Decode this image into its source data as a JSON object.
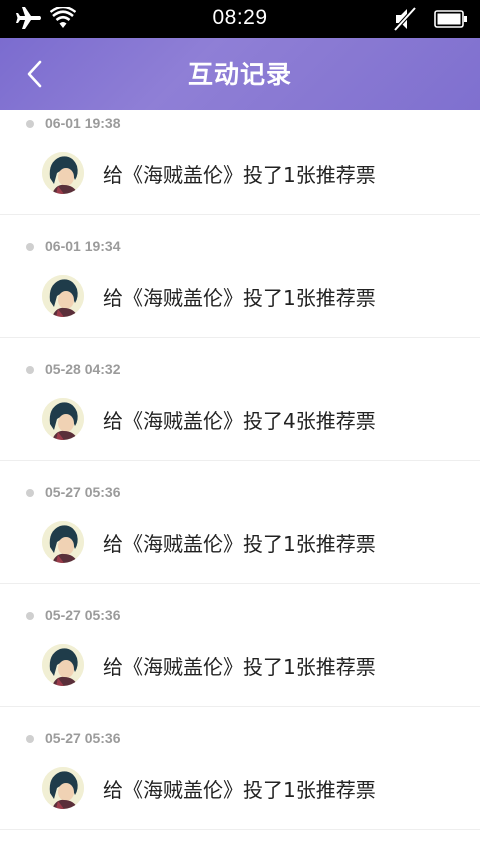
{
  "status_bar": {
    "time": "08:29",
    "icons": [
      "airplane-icon",
      "wifi-icon",
      "mute-icon",
      "battery-icon"
    ]
  },
  "header": {
    "title": "互动记录",
    "back_icon": "chevron-left-icon"
  },
  "records": [
    {
      "time": "06-01 19:38",
      "text": "给《海贼盖伦》投了1张推荐票"
    },
    {
      "time": "06-01 19:34",
      "text": "给《海贼盖伦》投了1张推荐票"
    },
    {
      "time": "05-28 04:32",
      "text": "给《海贼盖伦》投了4张推荐票"
    },
    {
      "time": "05-27 05:36",
      "text": "给《海贼盖伦》投了1张推荐票"
    },
    {
      "time": "05-27 05:36",
      "text": "给《海贼盖伦》投了1张推荐票"
    },
    {
      "time": "05-27 05:36",
      "text": "给《海贼盖伦》投了1张推荐票"
    }
  ],
  "colors": {
    "header_bg": "#8a7ad3",
    "status_bar_bg": "#000000",
    "timeline_dot": "#cfcfcf",
    "timestamp_text": "#9b9b9b"
  }
}
